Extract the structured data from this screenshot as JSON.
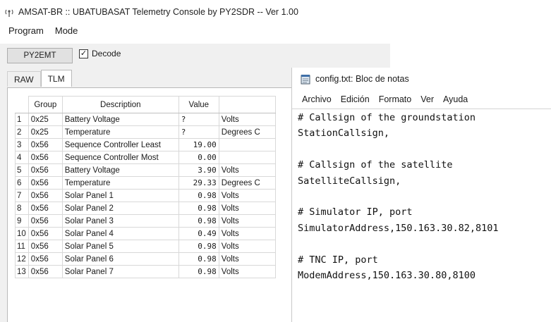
{
  "console": {
    "title": "AMSAT-BR :: UBATUBASAT Telemetry Console by PY2SDR -- Ver 1.00",
    "menu": [
      "Program",
      "Mode"
    ],
    "callsign_button": "PY2EMT",
    "decode_label": "Decode",
    "decode_checked": true,
    "tabs": [
      "RAW",
      "TLM"
    ],
    "active_tab": "TLM",
    "columns": [
      "Group",
      "Description",
      "Value"
    ],
    "rows": [
      {
        "n": "1",
        "group": "0x25",
        "desc": "Battery Voltage",
        "value": "?",
        "unit": "Volts"
      },
      {
        "n": "2",
        "group": "0x25",
        "desc": "Temperature",
        "value": "?",
        "unit": "Degrees C"
      },
      {
        "n": "3",
        "group": "0x56",
        "desc": "Sequence Controller Least",
        "value": "19.00",
        "unit": ""
      },
      {
        "n": "4",
        "group": "0x56",
        "desc": "Sequence Controller Most",
        "value": "0.00",
        "unit": ""
      },
      {
        "n": "5",
        "group": "0x56",
        "desc": "Battery Voltage",
        "value": "3.90",
        "unit": "Volts"
      },
      {
        "n": "6",
        "group": "0x56",
        "desc": "Temperature",
        "value": "29.33",
        "unit": "Degrees C"
      },
      {
        "n": "7",
        "group": "0x56",
        "desc": "Solar Panel 1",
        "value": "0.98",
        "unit": "Volts"
      },
      {
        "n": "8",
        "group": "0x56",
        "desc": "Solar Panel 2",
        "value": "0.98",
        "unit": "Volts"
      },
      {
        "n": "9",
        "group": "0x56",
        "desc": "Solar Panel 3",
        "value": "0.98",
        "unit": "Volts"
      },
      {
        "n": "10",
        "group": "0x56",
        "desc": "Solar Panel 4",
        "value": "0.49",
        "unit": "Volts"
      },
      {
        "n": "11",
        "group": "0x56",
        "desc": "Solar Panel 5",
        "value": "0.98",
        "unit": "Volts"
      },
      {
        "n": "12",
        "group": "0x56",
        "desc": "Solar Panel 6",
        "value": "0.98",
        "unit": "Volts"
      },
      {
        "n": "13",
        "group": "0x56",
        "desc": "Solar Panel 7",
        "value": "0.98",
        "unit": "Volts"
      }
    ]
  },
  "notepad": {
    "title": "config.txt: Bloc de notas",
    "menu": [
      "Archivo",
      "Edición",
      "Formato",
      "Ver",
      "Ayuda"
    ],
    "lines": [
      "# Callsign of the groundstation",
      "StationCallsign,",
      "",
      "# Callsign of the satellite",
      "SatelliteCallsign,",
      "",
      "# Simulator IP, port",
      "SimulatorAddress,150.163.30.82,8101",
      "",
      "# TNC IP, port",
      "ModemAddress,150.163.30.80,8100"
    ]
  }
}
